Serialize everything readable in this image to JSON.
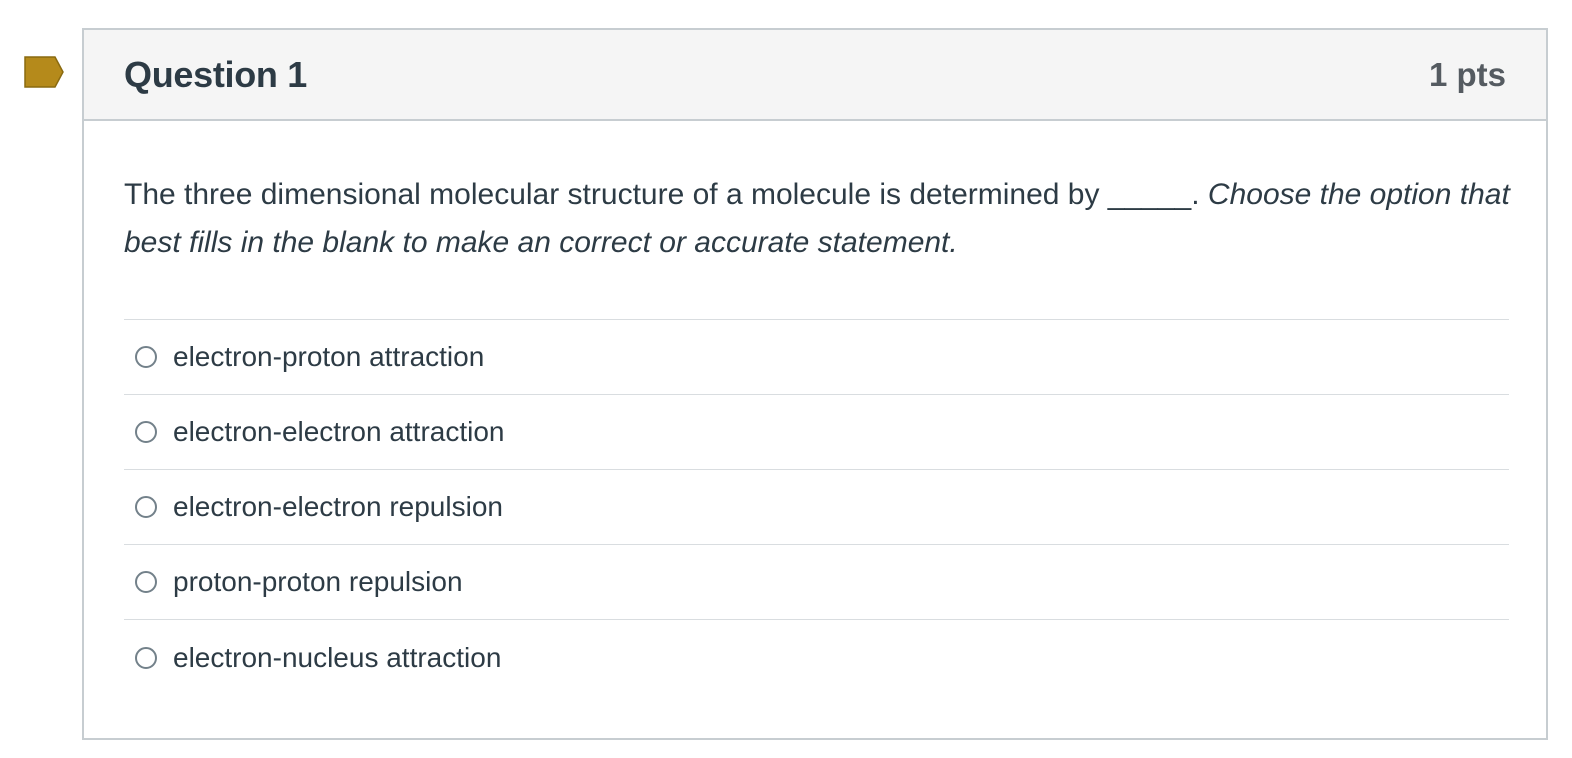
{
  "question": {
    "title": "Question 1",
    "points": "1 pts",
    "text_plain": "The three dimensional molecular structure of a molecule is determined by _____. ",
    "text_italic": "Choose the option that best fills in the blank to make an correct or accurate statement.",
    "flag_icon": "bookmark-flag-icon",
    "accent_color": "#b58a1b",
    "answers": [
      {
        "label": "electron-proton attraction",
        "selected": false
      },
      {
        "label": "electron-electron attraction",
        "selected": false
      },
      {
        "label": "electron-electron repulsion",
        "selected": false
      },
      {
        "label": "proton-proton repulsion",
        "selected": false
      },
      {
        "label": "electron-nucleus attraction",
        "selected": false
      }
    ]
  }
}
